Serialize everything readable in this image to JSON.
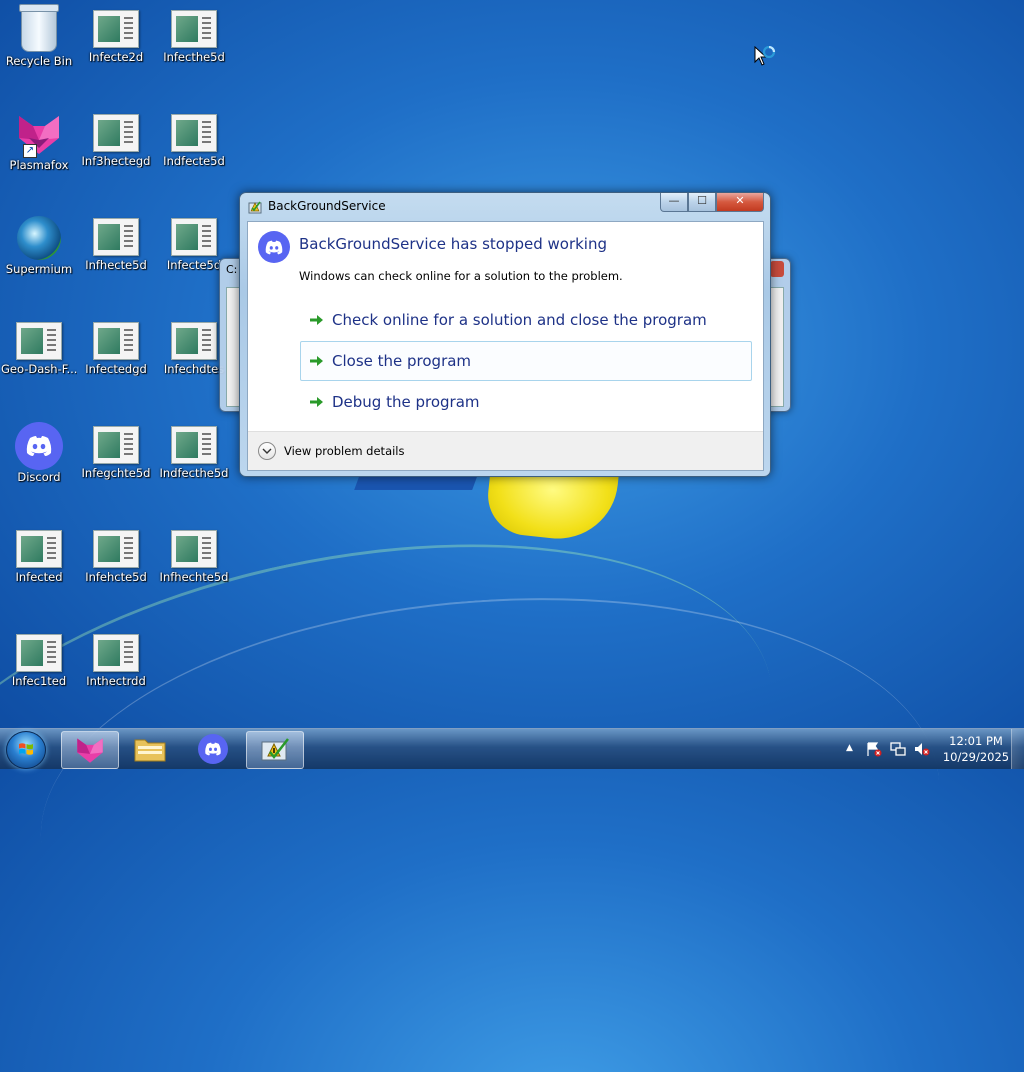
{
  "desktop": {
    "icons": [
      {
        "label": "Recycle Bin",
        "icon": "recycle-bin-icon"
      },
      {
        "label": "Infecte2d",
        "icon": "document-icon"
      },
      {
        "label": "Infecthe5d",
        "icon": "document-icon"
      },
      {
        "label": "Plasmafox",
        "icon": "plasmafox-icon"
      },
      {
        "label": "Inf3hectegd",
        "icon": "document-icon"
      },
      {
        "label": "Indfecte5d",
        "icon": "document-icon"
      },
      {
        "label": "Supermium",
        "icon": "supermium-icon"
      },
      {
        "label": "Infhecte5d",
        "icon": "document-icon"
      },
      {
        "label": "Infecte5d",
        "icon": "document-icon"
      },
      {
        "label": "Geo-Dash-F...",
        "icon": "document-icon"
      },
      {
        "label": "Infectedgd",
        "icon": "document-icon"
      },
      {
        "label": "Infechdtes",
        "icon": "document-icon"
      },
      {
        "label": "Discord",
        "icon": "discord-icon"
      },
      {
        "label": "Infegchte5d",
        "icon": "document-icon"
      },
      {
        "label": "Indfecthe5d",
        "icon": "document-icon"
      },
      {
        "label": "Infected",
        "icon": "document-icon"
      },
      {
        "label": "Infehcte5d",
        "icon": "document-icon"
      },
      {
        "label": "Infhechte5d",
        "icon": "document-icon"
      },
      {
        "label": "Infec1ted",
        "icon": "document-icon"
      },
      {
        "label": "Inthectrdd",
        "icon": "document-icon"
      }
    ]
  },
  "background_window": {
    "title": "C:"
  },
  "dialog": {
    "title": "BackGroundService",
    "heading": "BackGroundService has stopped working",
    "subtext": "Windows can check online for a solution to the problem.",
    "options": [
      {
        "label": "Check online for a solution and close the program"
      },
      {
        "label": "Close the program"
      },
      {
        "label": "Debug the program"
      }
    ],
    "details_label": "View problem details",
    "minimize_glyph": "—",
    "maximize_glyph": "☐",
    "close_glyph": "✕"
  },
  "taskbar": {
    "items": [
      {
        "name": "Plasmafox",
        "icon": "plasmafox-icon"
      },
      {
        "name": "Windows Explorer",
        "icon": "folder-icon"
      },
      {
        "name": "Discord",
        "icon": "discord-icon"
      },
      {
        "name": "Windows Error Reporting",
        "icon": "error-reporting-icon"
      }
    ],
    "clock": {
      "time": "12:01 PM",
      "date": "10/29/2025"
    },
    "tray_arrow": "▲"
  },
  "colors": {
    "dialog_heading": "#1e3287",
    "discord_brand": "#5865f2",
    "option_arrow": "#2a9a2a"
  }
}
